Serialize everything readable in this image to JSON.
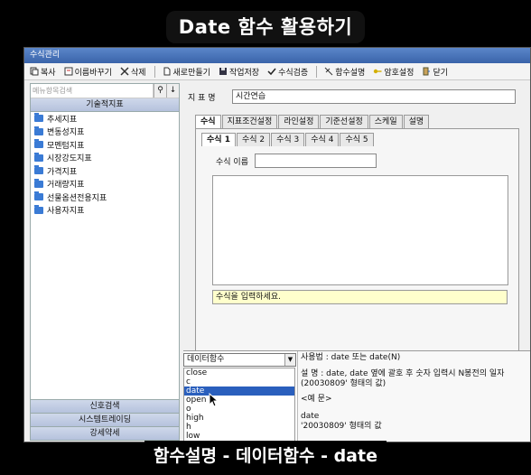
{
  "banner": "Date 함수 활용하기",
  "caption": "함수설명 - 데이터함수 - date",
  "window": {
    "title": "수식관리"
  },
  "toolbar": [
    {
      "label": "복사",
      "icon": "copy-icon"
    },
    {
      "label": "이름바꾸기",
      "icon": "rename-icon"
    },
    {
      "label": "삭제",
      "icon": "delete-icon"
    },
    {
      "label": "새로만들기",
      "icon": "new-document-icon"
    },
    {
      "label": "작업저장",
      "icon": "save-icon"
    },
    {
      "label": "수식검증",
      "icon": "check-icon"
    },
    {
      "label": "함수설명",
      "icon": "function-help-icon"
    },
    {
      "label": "암호설정",
      "icon": "key-icon"
    },
    {
      "label": "닫기",
      "icon": "close-door-icon"
    }
  ],
  "sidebar": {
    "search_placeholder": "메뉴항목검색",
    "group_title": "기술적지표",
    "items": [
      "추세지표",
      "변동성지표",
      "모멘텀지표",
      "시장강도지표",
      "가격지표",
      "거래량지표",
      "선물옵션전용지표",
      "사용자지표"
    ],
    "bottom_groups": [
      "신호검색",
      "시스템트레이딩",
      "강세약세"
    ]
  },
  "form": {
    "indicator_label": "지 표 명",
    "indicator_name": "시간연습",
    "tabs": [
      "수식",
      "지표조건설정",
      "라인설정",
      "기준선설정",
      "스케일",
      "설명"
    ],
    "sub_tabs": [
      "수식 1",
      "수식 2",
      "수식 3",
      "수식 4",
      "수식 5"
    ],
    "formula_name_label": "수식 이름",
    "formula_name_value": "",
    "hint": "수식을 입력하세요."
  },
  "functions": {
    "category": "데이터함수",
    "items": [
      "close",
      "c",
      "date",
      "open",
      "o",
      "high",
      "h",
      "low"
    ],
    "selected": "date",
    "description": {
      "usage": "사용법 : date 또는 date(N)",
      "explain": "설   명 : date, date 옆에 괄호 후 숫자 입력시 N봉전의 일자(20030809' 형태의 값)",
      "example_label": "<예 문>",
      "example_code": "date",
      "example_result": "'20030809' 형태의 값"
    }
  }
}
